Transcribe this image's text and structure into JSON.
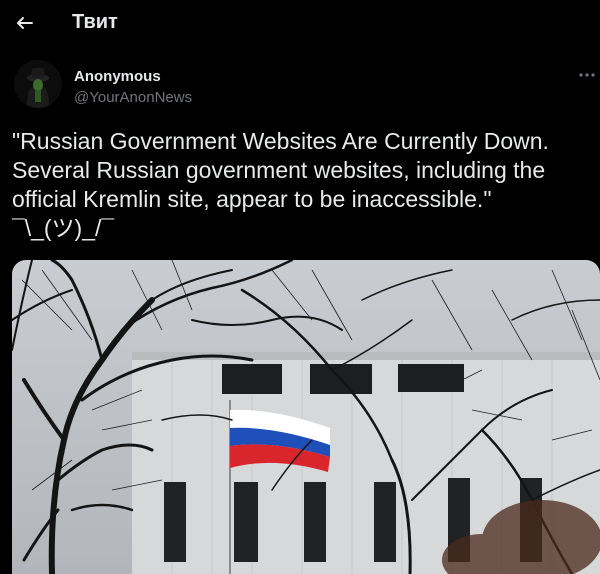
{
  "header": {
    "title": "Твит",
    "back_icon": "arrow-left-icon"
  },
  "author": {
    "name": "Anonymous",
    "handle": "@YourAnonNews",
    "avatar_icon": "hooded-figure-avatar"
  },
  "more_icon": "more-horizontal-icon",
  "tweet": {
    "text": "\"Russian Government Websites Are Currently Down. Several Russian government websites, including the official Kremlin site, appear to be inaccessible.\"\n¯\\_(ツ)_/¯"
  },
  "media": {
    "flag_colors": [
      "#ffffff",
      "#1f4fb8",
      "#d8262c"
    ]
  },
  "colors": {
    "background": "#000000",
    "text": "#e7e9ea",
    "secondary": "#71767b"
  }
}
